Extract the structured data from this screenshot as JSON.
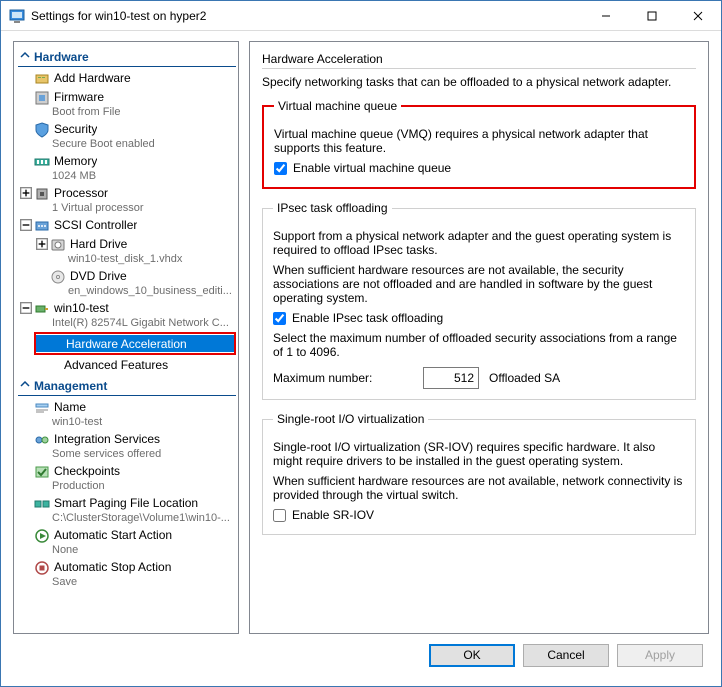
{
  "window": {
    "title": "Settings for win10-test on hyper2"
  },
  "tree": {
    "hardware_header": "Hardware",
    "management_header": "Management",
    "add_hardware": "Add Hardware",
    "firmware": "Firmware",
    "firmware_sub": "Boot from File",
    "security": "Security",
    "security_sub": "Secure Boot enabled",
    "memory": "Memory",
    "memory_sub": "1024 MB",
    "processor": "Processor",
    "processor_sub": "1 Virtual processor",
    "scsi": "SCSI Controller",
    "hard_drive": "Hard Drive",
    "hard_drive_sub": "win10-test_disk_1.vhdx",
    "dvd": "DVD Drive",
    "dvd_sub": "en_windows_10_business_editi...",
    "nic": "win10-test",
    "nic_sub": "Intel(R) 82574L Gigabit Network C...",
    "hw_accel": "Hardware Acceleration",
    "adv_feat": "Advanced Features",
    "name": "Name",
    "name_sub": "win10-test",
    "integ": "Integration Services",
    "integ_sub": "Some services offered",
    "checkpoints": "Checkpoints",
    "checkpoints_sub": "Production",
    "paging": "Smart Paging File Location",
    "paging_sub": "C:\\ClusterStorage\\Volume1\\win10-...",
    "auto_start": "Automatic Start Action",
    "auto_start_sub": "None",
    "auto_stop": "Automatic Stop Action",
    "auto_stop_sub": "Save"
  },
  "main": {
    "title": "Hardware Acceleration",
    "intro": "Specify networking tasks that can be offloaded to a physical network adapter.",
    "vmq": {
      "legend": "Virtual machine queue",
      "desc": "Virtual machine queue (VMQ) requires a physical network adapter that supports this feature.",
      "chk_label": "Enable virtual machine queue",
      "checked": true
    },
    "ipsec": {
      "legend": "IPsec task offloading",
      "desc1": "Support from a physical network adapter and the guest operating system is required to offload IPsec tasks.",
      "desc2": "When sufficient hardware resources are not available, the security associations are not offloaded and are handled in software by the guest operating system.",
      "chk_label": "Enable IPsec task offloading",
      "checked": true,
      "range": "Select the maximum number of offloaded security associations from a range of 1 to 4096.",
      "max_label": "Maximum number:",
      "max_value": "512",
      "max_suffix": "Offloaded SA"
    },
    "sriov": {
      "legend": "Single-root I/O virtualization",
      "desc1": "Single-root I/O virtualization (SR-IOV) requires specific hardware. It also might require drivers to be installed in the guest operating system.",
      "desc2": "When sufficient hardware resources are not available, network connectivity is provided through the virtual switch.",
      "chk_label": "Enable SR-IOV",
      "checked": false
    }
  },
  "buttons": {
    "ok": "OK",
    "cancel": "Cancel",
    "apply": "Apply"
  }
}
